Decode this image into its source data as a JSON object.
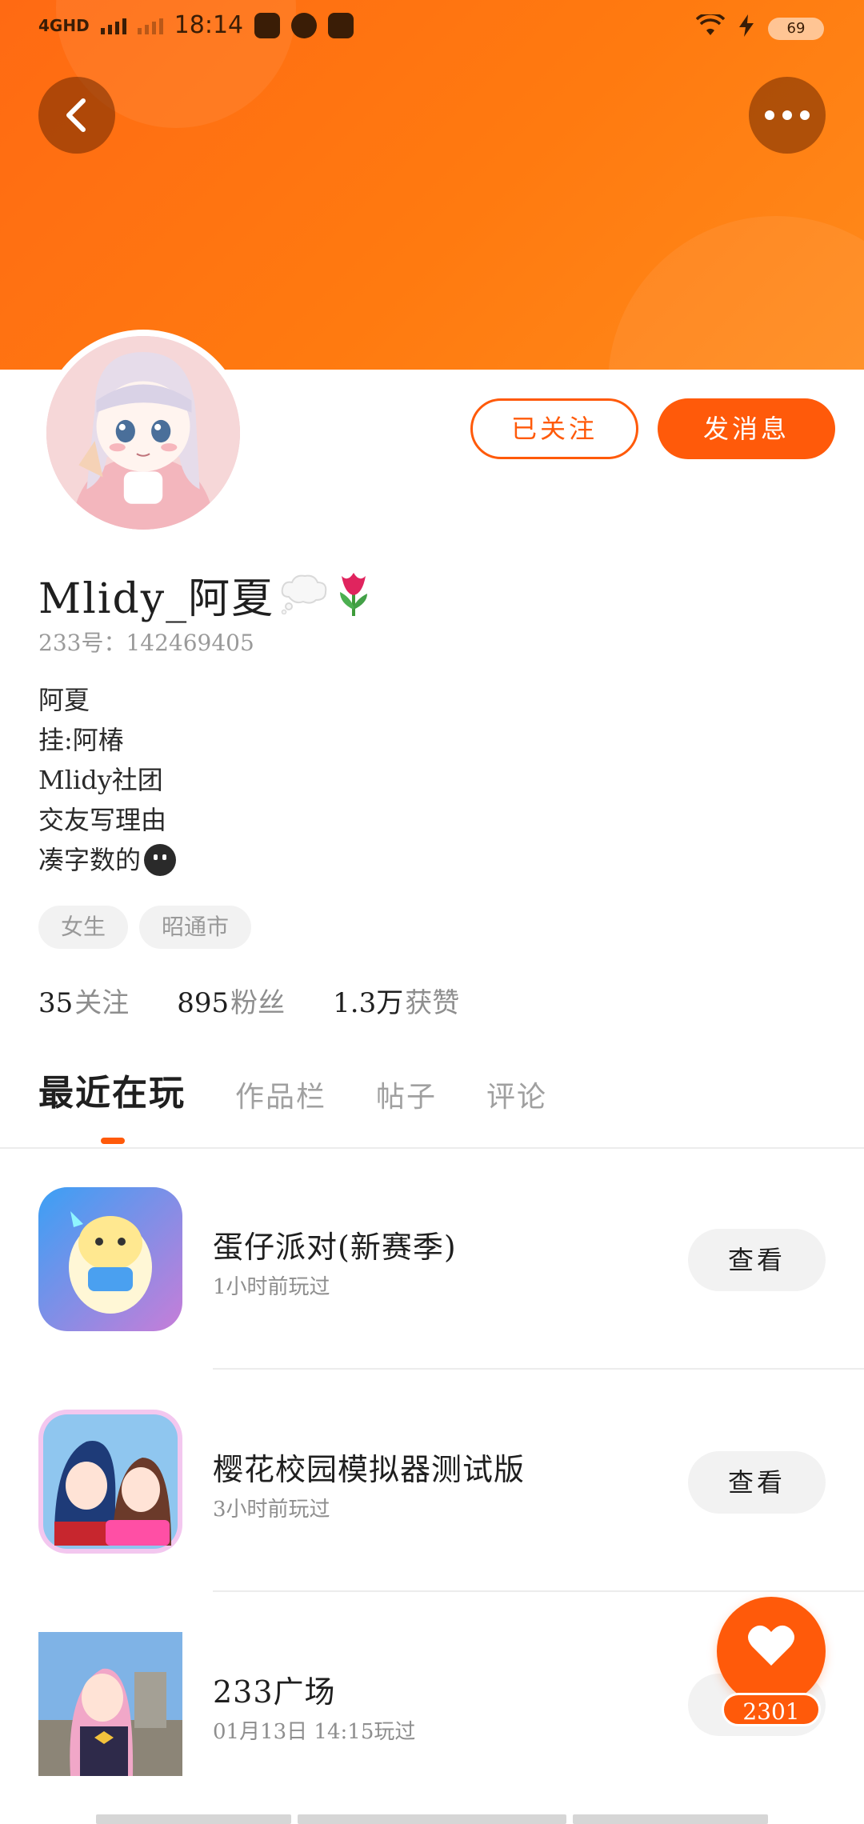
{
  "status_bar": {
    "network": "4GHD",
    "time": "18:14",
    "battery": "69"
  },
  "profile": {
    "username": "Mlidy_阿夏",
    "uid_label": "233号：",
    "uid": "142469405",
    "bio_lines": [
      "阿夏",
      "挂:阿椿",
      "Mlidy社团",
      "交友写理由",
      "凑字数的"
    ],
    "tags": [
      "女生",
      "昭通市"
    ],
    "follow_button": "已关注",
    "message_button": "发消息"
  },
  "stats": [
    {
      "value": "35",
      "label": "关注"
    },
    {
      "value": "895",
      "label": "粉丝"
    },
    {
      "value": "1.3万",
      "label": "获赞"
    }
  ],
  "tabs": [
    "最近在玩",
    "作品栏",
    "帖子",
    "评论"
  ],
  "games": [
    {
      "name": "蛋仔派对(新赛季)",
      "time": "1小时前玩过",
      "button": "查看"
    },
    {
      "name": "樱花校园模拟器测试版",
      "time": "3小时前玩过",
      "button": "查看"
    },
    {
      "name": "233广场",
      "time": "01月13日 14:15玩过",
      "button": "查看"
    }
  ],
  "like": {
    "count": "2301"
  },
  "colors": {
    "accent": "#ff5a0a",
    "header": "#ff7a10"
  }
}
